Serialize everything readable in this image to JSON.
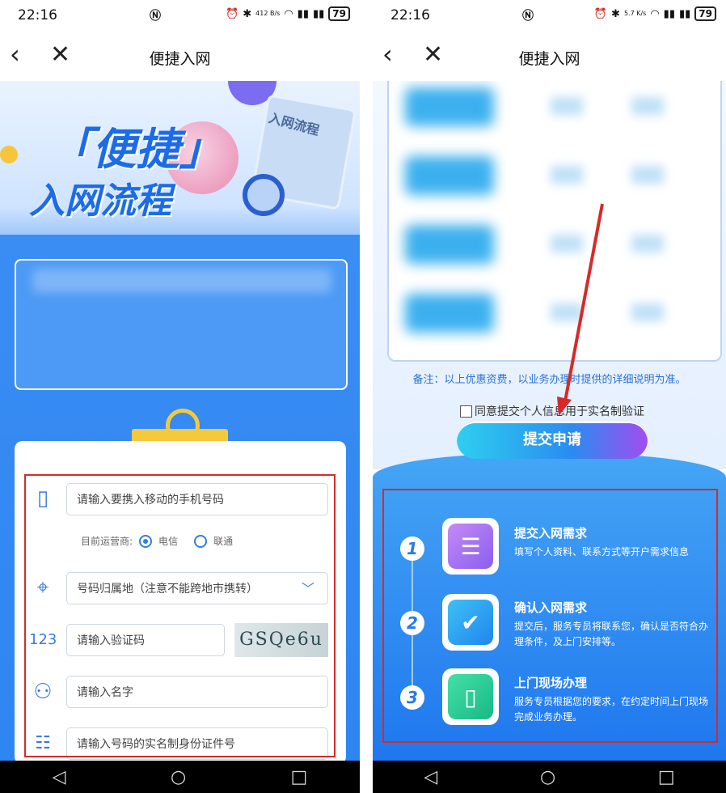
{
  "status_bar": {
    "time": "22:16",
    "battery": "79",
    "speed_left": "412 B/s",
    "speed_right": "5.7 K/s"
  },
  "navbar": {
    "title": "便捷入网"
  },
  "hero": {
    "line1": "「便捷」",
    "line2": "入网流程",
    "doc_label": "入网流程"
  },
  "form": {
    "phone_placeholder": "请输入要携入移动的手机号码",
    "carrier_label": "目前运营商:",
    "carrier_option1": "电信",
    "carrier_option2": "联通",
    "region_placeholder": "号码归属地（注意不能跨地市携转）",
    "code_placeholder": "请输入验证码",
    "captcha_text": "GSQe6u",
    "name_placeholder": "请输入名字",
    "id_placeholder": "请输入号码的实名制身份证件号"
  },
  "right": {
    "note": "备注：以上优惠资费，以业务办理时提供的详细说明为准。",
    "agree_label": "同意提交个人信息用于实名制验证",
    "submit_label": "提交申请",
    "steps": [
      {
        "num": "1",
        "title": "提交入网需求",
        "desc": "填写个人资料、联系方式等开户需求信息"
      },
      {
        "num": "2",
        "title": "确认入网需求",
        "desc": "提交后，服务专员将联系您，确认是否符合办理条件，及上门安排等。"
      },
      {
        "num": "3",
        "title": "上门现场办理",
        "desc": "服务专员根据您的要求，在约定时间上门现场完成业务办理。"
      }
    ]
  },
  "colors": {
    "accent": "#2b7fe6",
    "annotation_red": "#d62a2a"
  }
}
